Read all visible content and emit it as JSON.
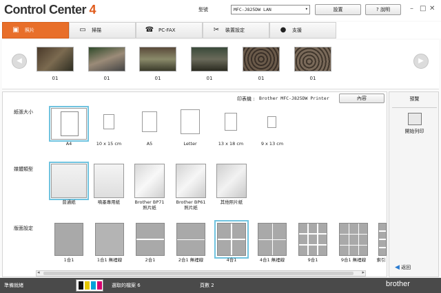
{
  "app": {
    "logo_main": "Control Center ",
    "logo_version": "4"
  },
  "header": {
    "model_label": "型號",
    "model_value": "MFC-J825DW LAN",
    "settings_label": "設置",
    "help_label": "說明"
  },
  "tabs": [
    {
      "label": "照片",
      "icon": "photo-icon",
      "active": true
    },
    {
      "label": "掃描",
      "icon": "scan-icon"
    },
    {
      "label": "PC-FAX",
      "icon": "fax-icon"
    },
    {
      "label": "裝置設定",
      "icon": "tools-icon"
    },
    {
      "label": "支援",
      "icon": "person-icon"
    }
  ],
  "thumbnails": [
    {
      "label": "01"
    },
    {
      "label": "01"
    },
    {
      "label": "01"
    },
    {
      "label": "01"
    },
    {
      "label": "01"
    },
    {
      "label": "01"
    }
  ],
  "printer": {
    "label": "印表機 :",
    "name": "Brother MFC-J825DW Printer",
    "properties_label": "內容"
  },
  "paper_size": {
    "label": "紙張大小",
    "options": [
      "A4",
      "10 x 15 cm",
      "A5",
      "Letter",
      "13 x 18 cm",
      "9 x 13 cm"
    ]
  },
  "media_type": {
    "label": "媒體類型",
    "options": [
      "普通紙",
      "噴墨專用紙",
      "Brother BP71\n照片紙",
      "Brother BP61\n照片紙",
      "其他照片紙"
    ]
  },
  "layout": {
    "label": "版面設定",
    "options": [
      "1合1",
      "1合1 無裡線",
      "2合1",
      "2合1 無裡線",
      "4合1",
      "4合1 無裡線",
      "9合1",
      "9合1 無裡線",
      "索引"
    ]
  },
  "right_panel": {
    "preview_label": "預覽",
    "print_label": "開始列印",
    "back_label": "返回"
  },
  "status": {
    "ready": "準備就緒",
    "selected_files": "選取的檔案 6",
    "pages": "頁數 2",
    "brand": "brother"
  },
  "ink_colors": [
    "#111111",
    "#e6c800",
    "#00a0d8",
    "#d4006e"
  ]
}
